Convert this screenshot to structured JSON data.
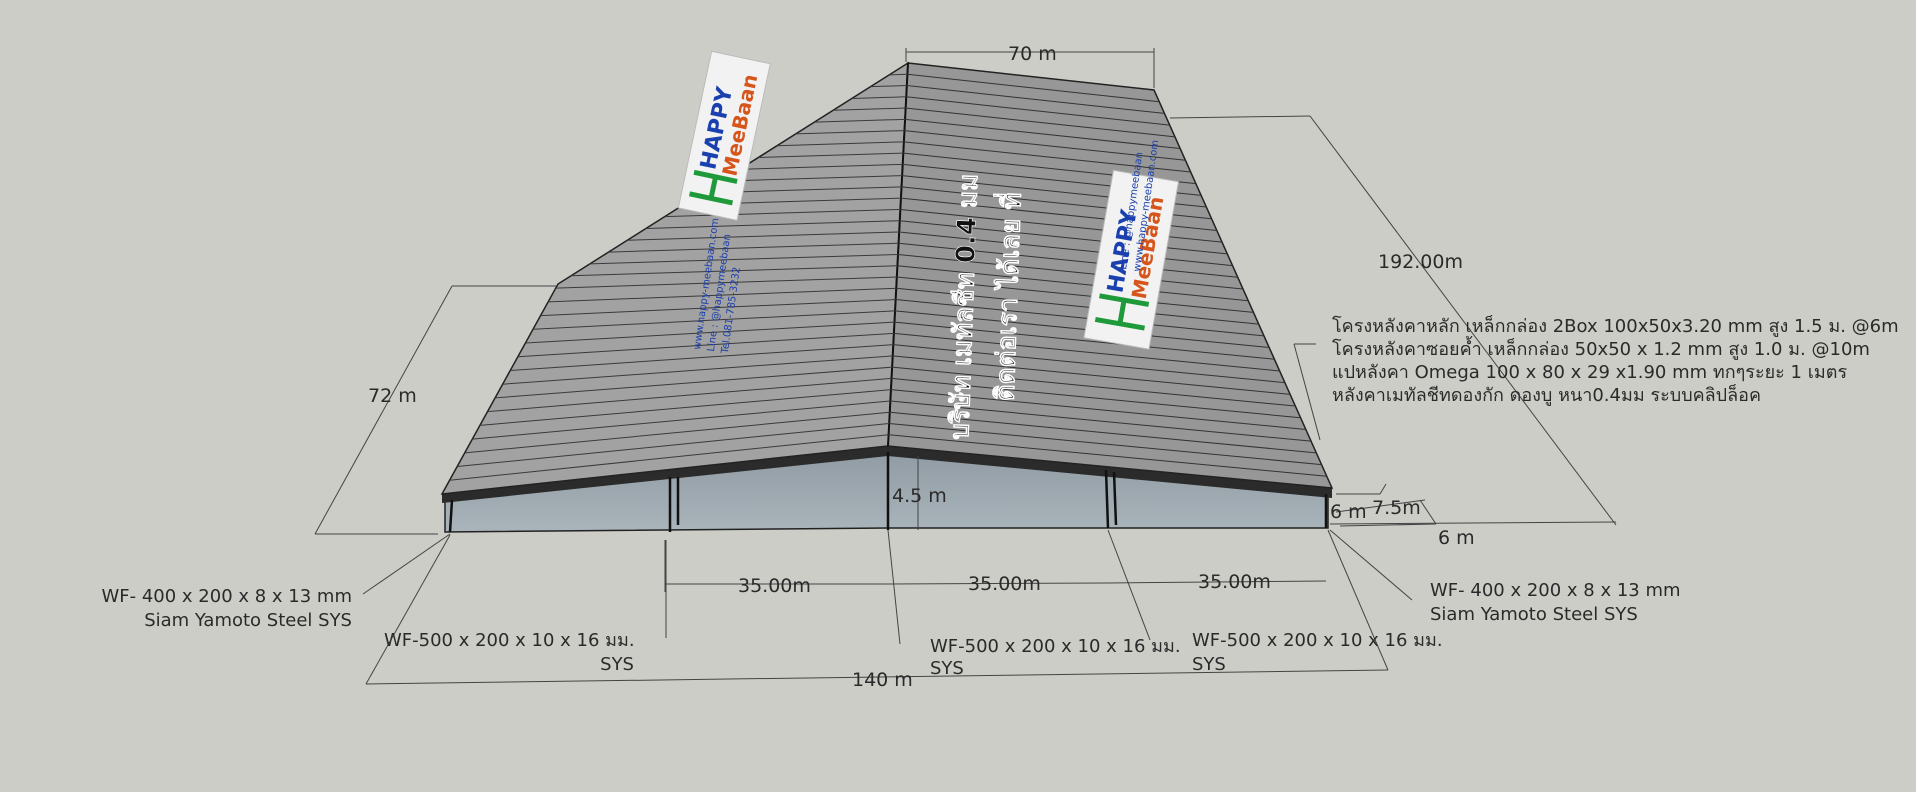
{
  "dimensions": {
    "top_width": "70 m",
    "side_length": "192.00m",
    "left_width": "72 m",
    "eave_height": "4.5 m",
    "span1": "35.00m",
    "span2": "35.00m",
    "span3": "35.00m",
    "total_length": "140 m",
    "overhang_a": "6 m",
    "overhang_b": "7.5m",
    "overhang_c": "6 m"
  },
  "notes": {
    "line1": "โครงหลังคาหลัก เหล็กกล่อง 2Box 100x50x3.20 mm สูง 1.5 ม. @6m",
    "line2": "โครงหลังคาซอยค้ำ เหล็กกล่อง 50x50 x 1.2 mm สูง 1.0 ม. @10m",
    "line3": "แปหลังคา Omega 100 x 80 x 29 x1.90 mm  ทกๆระยะ 1 เมตร",
    "line4": "หลังคาเมทัลชีทดองกัก ดองบู หนา0.4มม ระบบคลิปล็อค"
  },
  "column_specs": {
    "left_end_1": "WF- 400 x 200 x 8 x 13 mm",
    "left_end_2": "Siam Yamoto Steel  SYS",
    "right_end_1": "WF- 400 x 200 x 8 x 13 mm",
    "right_end_2": "Siam Yamoto Steel  SYS",
    "mid1_1": "WF-500 x 200 x 10 x 16 มม.",
    "mid1_2": "SYS",
    "mid2_1": "WF-500 x 200 x 10 x 16 มม.",
    "mid2_2": "SYS",
    "mid3_1": "WF-500 x 200 x 10 x 16 มม.",
    "mid3_2": "SYS"
  },
  "roof_text": {
    "line1": "ติดต่อเรา ได้เลย ที่",
    "line2": "บริษัท เมทัลชีท 0.4 มม"
  },
  "logo": {
    "brand_top": "HAPPY",
    "brand_bottom": "MeeBaan",
    "line": "Line : @happymeebaan",
    "web": "www.happy-meebaan.com",
    "tel": "Tel.081-785-3232"
  },
  "colors": {
    "background": "#cdcdc7",
    "roof": "#9b9b9b",
    "wall": "#9aa6ae",
    "logo_green": "#1f9a3b",
    "logo_blue": "#1a3fae",
    "logo_orange": "#d6551a"
  }
}
